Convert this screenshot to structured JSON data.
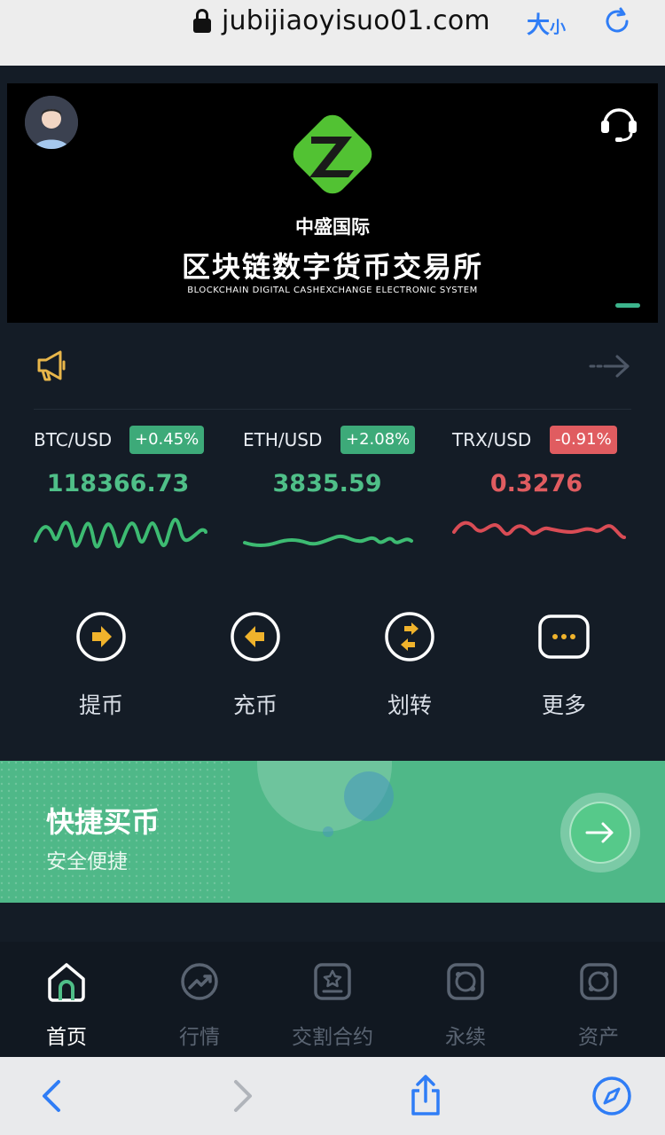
{
  "browser": {
    "url": "jubijiaoyisuo01.com",
    "textsize_big": "大",
    "textsize_small": "小",
    "accent": "#2f7df6"
  },
  "banner": {
    "brand_name": "中盛国际",
    "headline": "区块链数字货币交易所",
    "tagline": "BLOCKCHAIN  DIGITAL CASHEXCHANGE ELECTRONIC SYSTEM",
    "logo_letter": "Z",
    "logo_color": "#52c233"
  },
  "tickers": [
    {
      "pair": "BTC/USD",
      "change": "+0.45%",
      "price": "118366.73",
      "trend": "up",
      "color": "#4fbf88"
    },
    {
      "pair": "ETH/USD",
      "change": "+2.08%",
      "price": "3835.59",
      "trend": "up",
      "color": "#4fbf88"
    },
    {
      "pair": "TRX/USD",
      "change": "-0.91%",
      "price": "0.3276",
      "trend": "down",
      "color": "#e05c60"
    }
  ],
  "actions": [
    {
      "label": "提币",
      "icon": "withdraw-icon"
    },
    {
      "label": "充币",
      "icon": "deposit-icon"
    },
    {
      "label": "划转",
      "icon": "transfer-icon"
    },
    {
      "label": "更多",
      "icon": "more-icon"
    }
  ],
  "promo": {
    "title": "快捷买币",
    "subtitle": "安全便捷"
  },
  "tabs": [
    {
      "label": "首页",
      "icon": "home-icon",
      "active": true
    },
    {
      "label": "行情",
      "icon": "market-icon",
      "active": false
    },
    {
      "label": "交割合约",
      "icon": "delivery-contract-icon",
      "active": false
    },
    {
      "label": "永续",
      "icon": "perpetual-icon",
      "active": false
    },
    {
      "label": "资产",
      "icon": "assets-icon",
      "active": false
    }
  ]
}
